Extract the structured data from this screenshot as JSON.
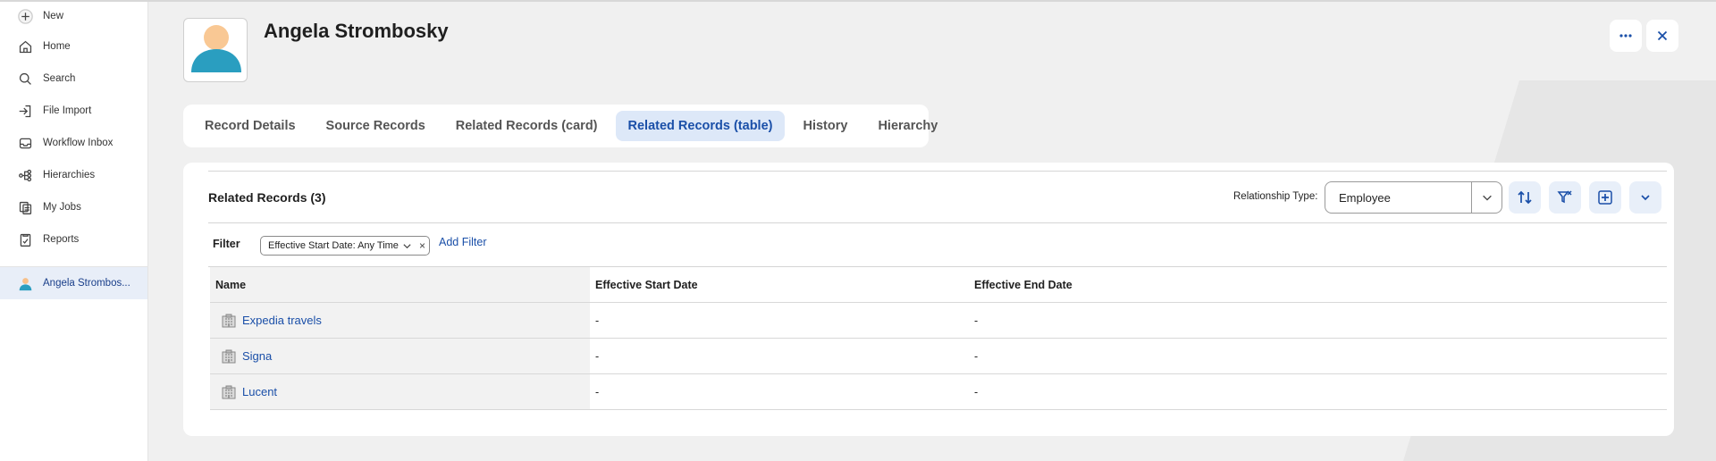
{
  "sidebar": {
    "items": [
      {
        "label": "New",
        "icon": "plus-icon"
      },
      {
        "label": "Home",
        "icon": "home-icon"
      },
      {
        "label": "Search",
        "icon": "search-icon"
      },
      {
        "label": "File Import",
        "icon": "file-import-icon"
      },
      {
        "label": "Workflow Inbox",
        "icon": "inbox-icon"
      },
      {
        "label": "Hierarchies",
        "icon": "hierarchy-icon"
      },
      {
        "label": "My Jobs",
        "icon": "jobs-icon"
      },
      {
        "label": "Reports",
        "icon": "reports-icon"
      }
    ],
    "active_record": "Angela Strombos..."
  },
  "header": {
    "title": "Angela Strombosky",
    "more_icon": "ellipsis-icon",
    "close_icon": "close-icon"
  },
  "tabs": [
    {
      "label": "Record Details",
      "active": false
    },
    {
      "label": "Source Records",
      "active": false
    },
    {
      "label": "Related Records (card)",
      "active": false
    },
    {
      "label": "Related Records (table)",
      "active": true
    },
    {
      "label": "History",
      "active": false
    },
    {
      "label": "Hierarchy",
      "active": false
    }
  ],
  "card": {
    "title": "Related Records (3)",
    "relationship_label": "Relationship Type:",
    "relationship_value": "Employee",
    "filter_label": "Filter",
    "filter_chip": "Effective Start Date: Any Time",
    "add_filter": "Add Filter"
  },
  "table": {
    "columns": [
      "Name",
      "Effective Start Date",
      "Effective End Date"
    ],
    "rows": [
      {
        "name": "Expedia travels",
        "start": "-",
        "end": "-"
      },
      {
        "name": "Signa",
        "start": "-",
        "end": "-"
      },
      {
        "name": "Lucent",
        "start": "-",
        "end": "-"
      }
    ]
  },
  "colors": {
    "accent": "#1a4fa8",
    "active_tab_bg": "#dde8f8",
    "tool_btn_bg": "#e8eff9",
    "page_bg": "#f0f0f0"
  }
}
